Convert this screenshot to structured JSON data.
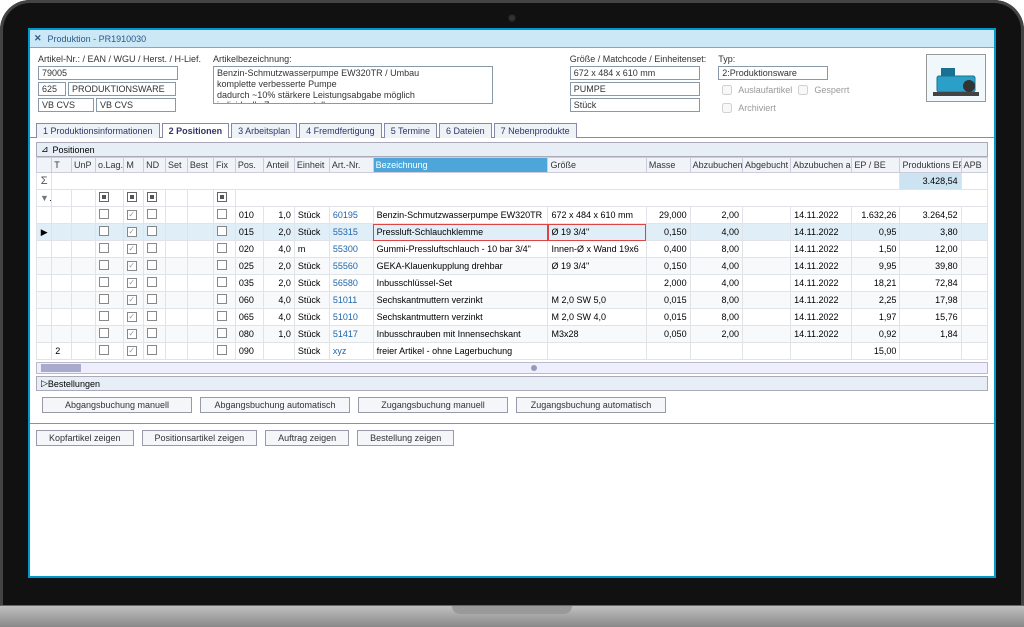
{
  "window": {
    "title": "Produktion - PR1910030"
  },
  "header": {
    "artikel_label": "Artikel-Nr.: / EAN / WGU / Herst. / H-Lief.",
    "artikel_nr": "79005",
    "wgu_code": "625",
    "wgu_name": "PRODUKTIONSWARE",
    "herst": "VB CVS",
    "hlief": "VB CVS",
    "bezeichnung_label": "Artikelbezeichnung:",
    "bezeichnung": "Benzin-Schmutzwasserpumpe EW320TR / Umbau\nkomplette verbesserte Pumpe\ndadurch ~10% stärkere Leistungsabgabe möglich\nindividuelle Zusammenstellung",
    "groesse_label": "Größe / Matchcode / Einheitenset:",
    "groesse": "672 x 484 x 610 mm",
    "matchcode": "PUMPE",
    "einheit": "Stück",
    "typ_label": "Typ:",
    "typ": "2:Produktionsware",
    "flag_auslauf": "Auslaufartikel",
    "flag_gesperrt": "Gesperrt",
    "flag_archiviert": "Archiviert"
  },
  "tabs": [
    {
      "label": "1 Produktionsinformationen"
    },
    {
      "label": "2 Positionen"
    },
    {
      "label": "3 Arbeitsplan"
    },
    {
      "label": "4 Fremdfertigung"
    },
    {
      "label": "5 Termine"
    },
    {
      "label": "6 Dateien"
    },
    {
      "label": "7 Nebenprodukte"
    }
  ],
  "grid": {
    "section_title": "Positionen",
    "section_bestellungen": "Bestellungen",
    "columns": [
      "T",
      "UnP",
      "o.Lag.",
      "M",
      "ND",
      "Set",
      "Best",
      "Fix",
      "Pos.",
      "Anteil",
      "Einheit",
      "Art.-Nr.",
      "Bezeichnung",
      "Größe",
      "Masse",
      "Abzubuchen",
      "Abgebucht",
      "Abzubuchen am",
      "EP / BE",
      "Produktions EP",
      "APB"
    ],
    "sum_row": {
      "prod_ep": "3.428,54"
    },
    "rows": [
      {
        "m": true,
        "pos": "010",
        "anteil": "1,0",
        "einheit": "Stück",
        "artnr": "60195",
        "bez": "Benzin-Schmutzwasserpumpe EW320TR",
        "groesse": "672 x 484 x 610 mm",
        "masse": "29,000",
        "abzubuchen": "2,00",
        "am": "14.11.2022",
        "ep": "1.632,26",
        "pep": "3.264,52"
      },
      {
        "m": true,
        "pos": "015",
        "anteil": "2,0",
        "einheit": "Stück",
        "artnr": "55315",
        "bez": "Pressluft-Schlauchklemme",
        "groesse": "Ø 19 3/4\"",
        "masse": "0,150",
        "abzubuchen": "4,00",
        "am": "14.11.2022",
        "ep": "0,95",
        "pep": "3,80",
        "hl": true,
        "selected": true
      },
      {
        "m": true,
        "pos": "020",
        "anteil": "4,0",
        "einheit": "m",
        "artnr": "55300",
        "bez": "Gummi-Pressluftschlauch - 10 bar 3/4\"",
        "groesse": "Innen-Ø x Wand 19x6",
        "masse": "0,400",
        "abzubuchen": "8,00",
        "am": "14.11.2022",
        "ep": "1,50",
        "pep": "12,00"
      },
      {
        "m": true,
        "pos": "025",
        "anteil": "2,0",
        "einheit": "Stück",
        "artnr": "55560",
        "bez": "GEKA-Klauenkupplung drehbar",
        "groesse": "Ø 19 3/4\"",
        "masse": "0,150",
        "abzubuchen": "4,00",
        "am": "14.11.2022",
        "ep": "9,95",
        "pep": "39,80"
      },
      {
        "m": true,
        "pos": "035",
        "anteil": "2,0",
        "einheit": "Stück",
        "artnr": "56580",
        "bez": "Inbusschlüssel-Set",
        "groesse": "",
        "masse": "2,000",
        "abzubuchen": "4,00",
        "am": "14.11.2022",
        "ep": "18,21",
        "pep": "72,84"
      },
      {
        "m": true,
        "pos": "060",
        "anteil": "4,0",
        "einheit": "Stück",
        "artnr": "51011",
        "bez": "Sechskantmuttern verzinkt",
        "groesse": "M 2,0 SW 5,0",
        "masse": "0,015",
        "abzubuchen": "8,00",
        "am": "14.11.2022",
        "ep": "2,25",
        "pep": "17,98"
      },
      {
        "m": true,
        "pos": "065",
        "anteil": "4,0",
        "einheit": "Stück",
        "artnr": "51010",
        "bez": "Sechskantmuttern verzinkt",
        "groesse": "M 2,0 SW 4,0",
        "masse": "0,015",
        "abzubuchen": "8,00",
        "am": "14.11.2022",
        "ep": "1,97",
        "pep": "15,76"
      },
      {
        "m": true,
        "pos": "080",
        "anteil": "1,0",
        "einheit": "Stück",
        "artnr": "51417",
        "bez": "Inbusschrauben mit Innensechskant",
        "groesse": "M3x28",
        "masse": "0,050",
        "abzubuchen": "2,00",
        "am": "14.11.2022",
        "ep": "0,92",
        "pep": "1,84"
      },
      {
        "t": "2",
        "m": true,
        "pos": "090",
        "anteil": "",
        "einheit": "Stück",
        "artnr": "xyz",
        "bez": "freier Artikel - ohne Lagerbuchung",
        "groesse": "",
        "masse": "",
        "abzubuchen": "",
        "am": "",
        "ep": "15,00",
        "pep": ""
      }
    ]
  },
  "action_buttons": {
    "b1": "Abgangsbuchung manuell",
    "b2": "Abgangsbuchung automatisch",
    "b3": "Zugangsbuchung manuell",
    "b4": "Zugangsbuchung automatisch"
  },
  "footer_buttons": {
    "b1": "Kopfartikel zeigen",
    "b2": "Positionsartikel zeigen",
    "b3": "Auftrag zeigen",
    "b4": "Bestellung zeigen"
  }
}
